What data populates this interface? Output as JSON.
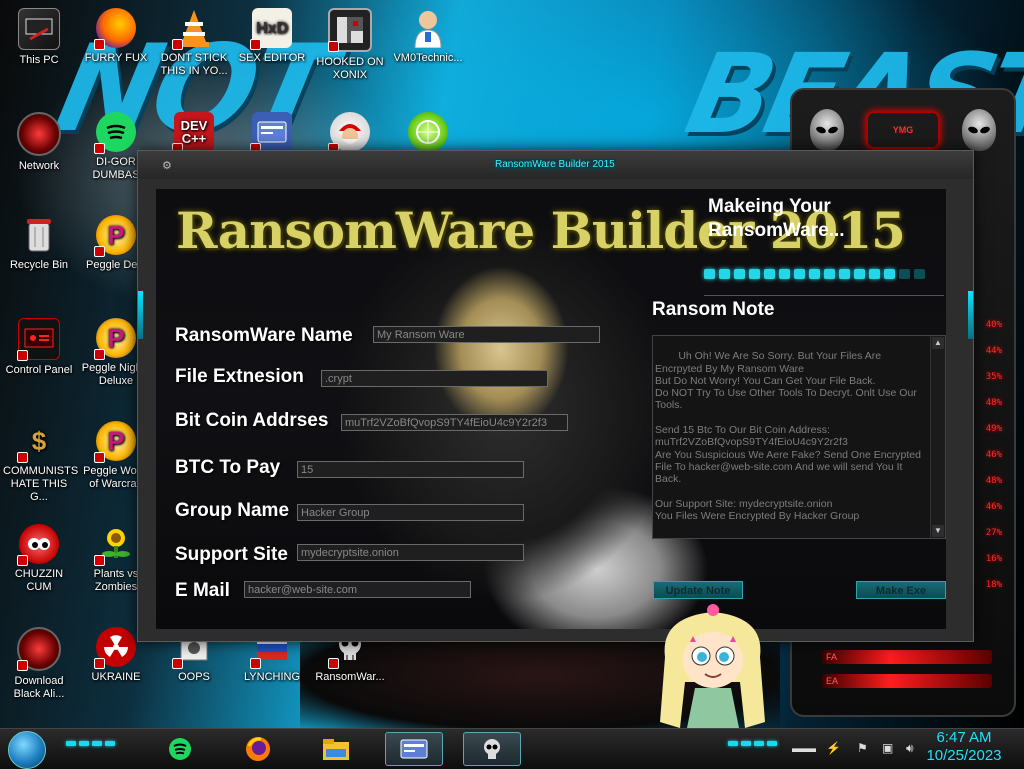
{
  "desktop": {
    "wallpaper_text_left": "NOT",
    "wallpaper_text_right": "BEAST",
    "icons": [
      {
        "label": "This PC"
      },
      {
        "label": "FURRY FUX"
      },
      {
        "label": "DONT STICK THIS IN YO..."
      },
      {
        "label": "SEX EDITOR"
      },
      {
        "label": "HOOKED ON XONIX"
      },
      {
        "label": "VM0Technic..."
      },
      {
        "label": "Network"
      },
      {
        "label": "DI-GOR DUMBAS"
      },
      {
        "label": "Recycle Bin"
      },
      {
        "label": "Peggle Delu"
      },
      {
        "label": "Control Panel"
      },
      {
        "label": "Peggle Nights Deluxe"
      },
      {
        "label": "COMMUNISTS HATE THIS G..."
      },
      {
        "label": "Peggle World of Warcraft"
      },
      {
        "label": "CHUZZIN CUM"
      },
      {
        "label": "Plants vs Zombies"
      },
      {
        "label": "Download Black Ali..."
      },
      {
        "label": "UKRAINE"
      },
      {
        "label": "OOPS"
      },
      {
        "label": "LYNCHING"
      },
      {
        "label": "RansomWar..."
      }
    ],
    "extra_icons": [
      "DEV C++",
      "Crd",
      "Lime"
    ]
  },
  "gadget": {
    "badge": "YMG",
    "meters": [
      "40%",
      "44%",
      "35%",
      "48%",
      "49%",
      "46%",
      "48%",
      "46%",
      "27%",
      "16%",
      "18%"
    ],
    "bars": [
      "FA",
      "EA"
    ]
  },
  "window": {
    "title": "RansomWare Builder 2015",
    "logo": "RansomWare Builder 2015",
    "status": "Makeing Your RansomWare...",
    "progress": 0.86,
    "fields": {
      "name_label": "RansomWare Name",
      "name_value": "My Ransom Ware",
      "ext_label": "File Extnesion",
      "ext_value": ".crypt",
      "btc_addr_label": "Bit Coin Addrses",
      "btc_addr_value": "muTrf2VZoBfQvopS9TY4fEioU4c9Y2r2f3",
      "btc_pay_label": "BTC To Pay",
      "btc_pay_value": "15",
      "group_label": "Group Name",
      "group_value": "Hacker Group",
      "site_label": "Support Site",
      "site_value": "mydecryptsite.onion",
      "email_label": "E Mail",
      "email_value": "hacker@web-site.com"
    },
    "note_title": "Ransom Note",
    "note_text": "Uh Oh! We Are So Sorry. But Your Files Are Encrpyted By My Ransom Ware\nBut Do Not Worry! You Can Get Your File Back.\nDo NOT Try To Use Other Tools To Decryt. Onlt Use Our Tools.\n\nSend 15 Btc To Our Bit Coin Address:\nmuTrf2VZoBfQvopS9TY4fEioU4c9Y2r2f3\nAre You Suspicious We Aere Fake? Send One Encrypted File To hacker@web-site.com And we will send You It Back.\n\nOur Support Site: mydecryptsite.onion\nYou Files Were Encrypted By Hacker Group",
    "update_button": "Update Note",
    "make_button": "Make Exe"
  },
  "taskbar": {
    "apps": [
      "spotify-icon",
      "firefox-icon",
      "file-explorer-icon",
      "ransomware-builder-icon",
      "skull-app-icon"
    ],
    "time": "6:47 AM",
    "date": "10/25/2023"
  },
  "colors": {
    "accent_cyan": "#1ee0ff",
    "logo_gold": "#d8d166",
    "gadget_red": "#ff2b2b"
  }
}
